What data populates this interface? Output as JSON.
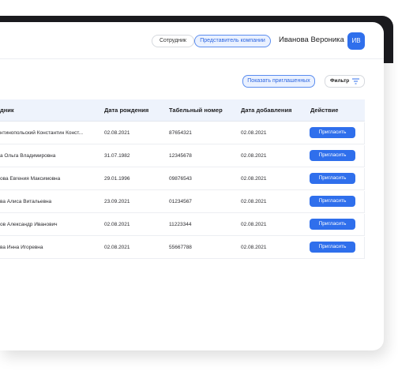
{
  "header": {
    "role_staff": "Сотрудник",
    "role_rep": "Представитель компании",
    "user_name": "Иванова Вероника",
    "avatar_initials": "ИВ"
  },
  "toolbar": {
    "show_invited": "Показать приглашенных",
    "filter_label": "Фильтр"
  },
  "table": {
    "headers": [
      "дник",
      "Дата рождения",
      "Табельный номер",
      "Дата добавления",
      "Действие"
    ],
    "rows": [
      {
        "name": "нтинопольский Константин Конст...",
        "birth": "02.08.2021",
        "number": "87654321",
        "added": "02.08.2021",
        "action": "Пригласить"
      },
      {
        "name": "а Ольга Владимировна",
        "birth": "31.07.1982",
        "number": "12345678",
        "added": "02.08.2021",
        "action": "Пригласить"
      },
      {
        "name": "ова Евгения Максимовна",
        "birth": "29.01.1996",
        "number": "09876543",
        "added": "02.08.2021",
        "action": "Пригласить"
      },
      {
        "name": "ва Алиса Витальевна",
        "birth": "23.09.2021",
        "number": "01234567",
        "added": "02.08.2021",
        "action": "Пригласить"
      },
      {
        "name": "ов Александр Иванович",
        "birth": "02.08.2021",
        "number": "11223344",
        "added": "02.08.2021",
        "action": "Пригласить"
      },
      {
        "name": "ва Инна Игоревна",
        "birth": "02.08.2021",
        "number": "55667788",
        "added": "02.08.2021",
        "action": "Пригласить"
      }
    ]
  },
  "colors": {
    "accent": "#2f6fec",
    "header_bg": "#eef3fc",
    "dark_frame": "#1b1b1f"
  },
  "icons": {
    "filter": "filter-icon"
  }
}
